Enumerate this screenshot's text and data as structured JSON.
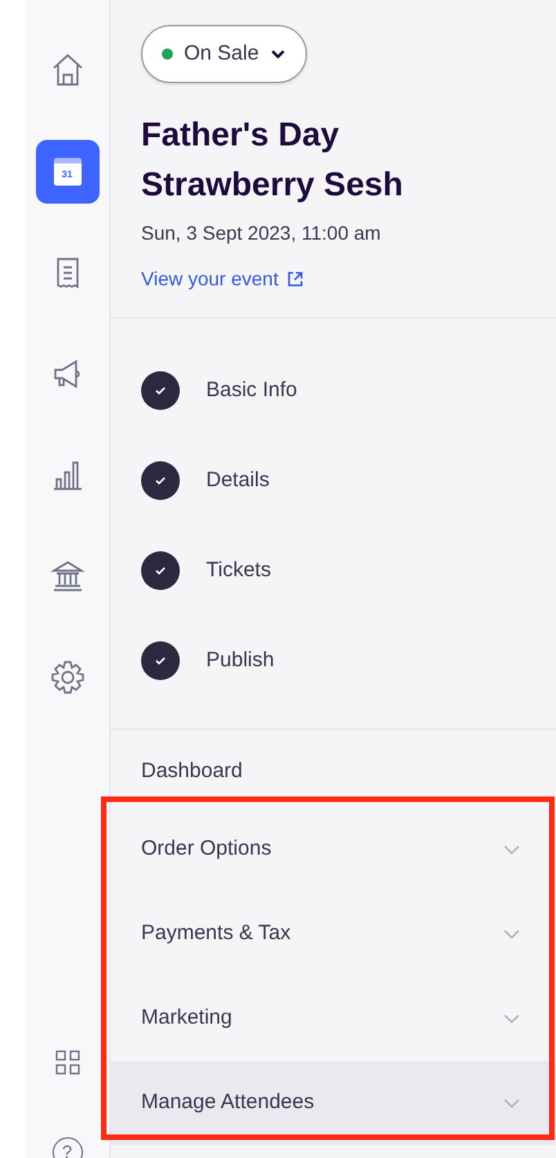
{
  "rail": [
    {
      "kind": "home",
      "selected": false
    },
    {
      "kind": "calendar",
      "selected": true,
      "label": "31"
    },
    {
      "kind": "receipt",
      "selected": false
    },
    {
      "kind": "megaphone",
      "selected": false
    },
    {
      "kind": "chart",
      "selected": false
    },
    {
      "kind": "bank",
      "selected": false
    },
    {
      "kind": "gear",
      "selected": false
    }
  ],
  "rail_bottom": [
    {
      "kind": "grid"
    },
    {
      "kind": "help",
      "label": "?"
    }
  ],
  "status": {
    "label": "On Sale",
    "color": "#1ea357"
  },
  "event": {
    "title": "Father's Day Strawberry Sesh",
    "date": "Sun, 3 Sept 2023, 11:00 am",
    "link": "View your event"
  },
  "steps": [
    {
      "label": "Basic Info",
      "checked": true
    },
    {
      "label": "Details",
      "checked": true
    },
    {
      "label": "Tickets",
      "checked": true
    },
    {
      "label": "Publish",
      "checked": true
    }
  ],
  "dashboard": "Dashboard",
  "sections": [
    {
      "label": "Order Options",
      "selected": false
    },
    {
      "label": "Payments & Tax",
      "selected": false
    },
    {
      "label": "Marketing",
      "selected": false
    },
    {
      "label": "Manage Attendees",
      "selected": true
    }
  ]
}
